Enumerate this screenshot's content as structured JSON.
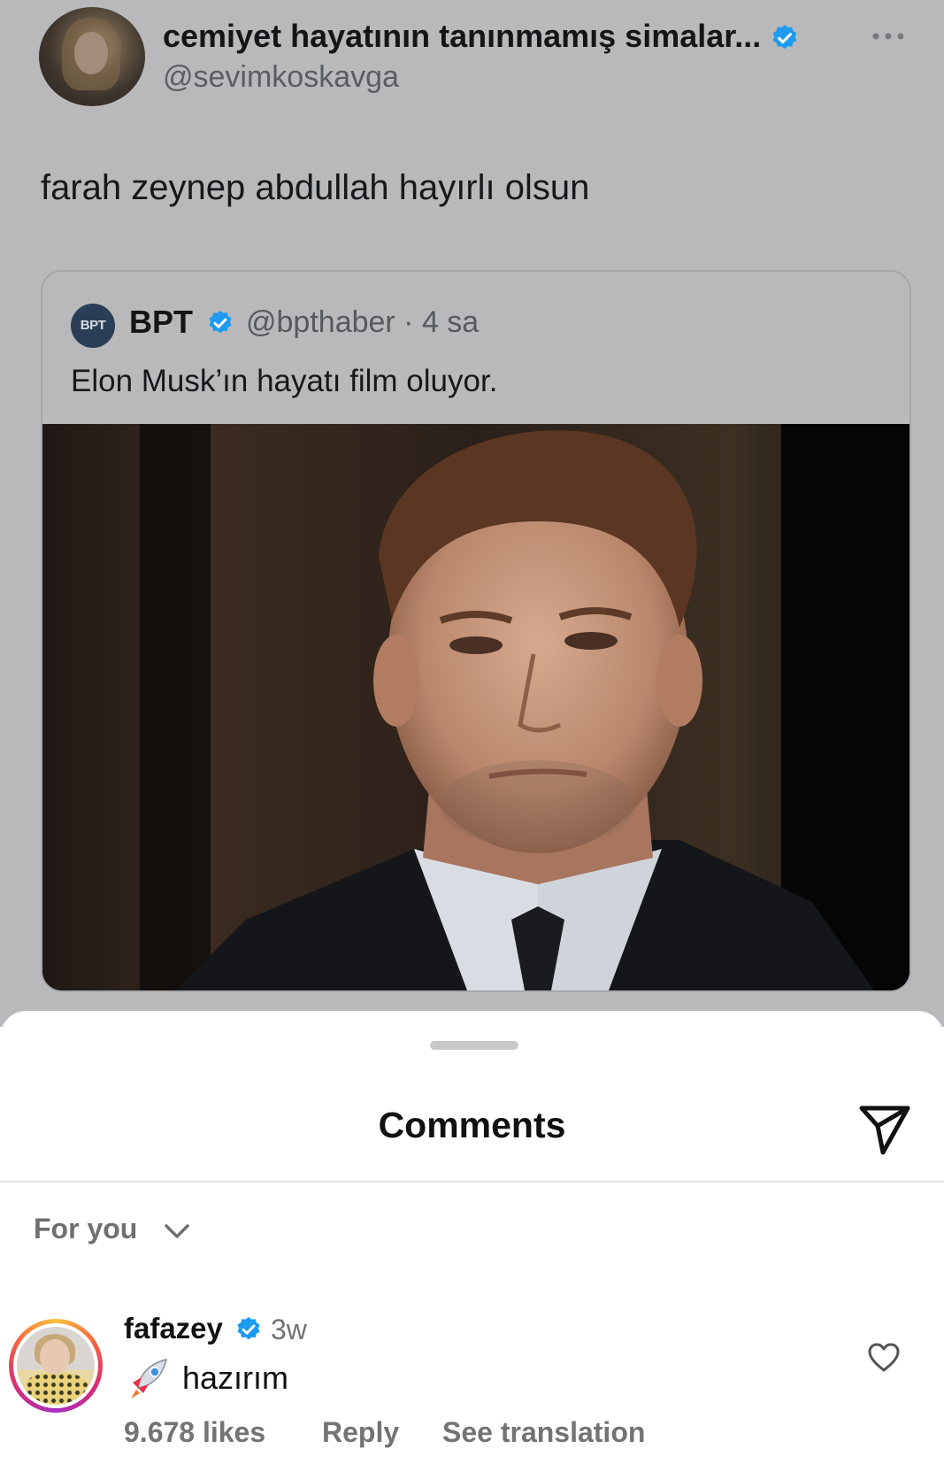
{
  "tweet": {
    "display_name": "cemiyet hayatının tanınmamış simalar...",
    "handle": "@sevimkoskavga",
    "text": "farah zeynep abdullah hayırlı olsun",
    "quote": {
      "avatar_text": "BPT",
      "name": "BPT",
      "handle_time": "@bpthaber · 4 sa",
      "text": "Elon Musk’ın hayatı film oluyor."
    }
  },
  "sheet": {
    "title": "Comments",
    "sort_label": "For you",
    "comment": {
      "username": "fafazey",
      "time": "3w",
      "text": "hazırım",
      "likes": "9.678 likes",
      "reply": "Reply",
      "see_translation": "See translation"
    }
  },
  "icons": [
    "more-icon",
    "verified-icon",
    "send-icon",
    "chevron-down-icon",
    "rocket-icon",
    "heart-icon"
  ],
  "colors": {
    "verified": "#1d9bf0",
    "overlay": "#b9b9bb"
  }
}
